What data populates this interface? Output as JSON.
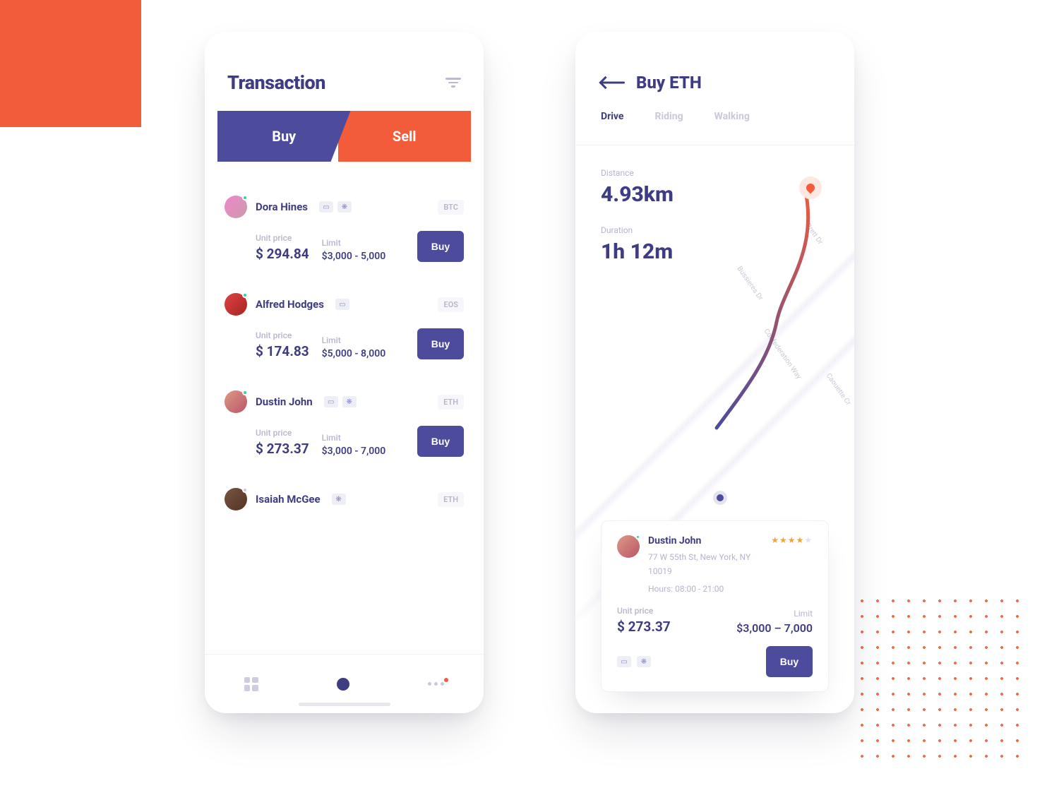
{
  "colors": {
    "primary": "#4D4B9B",
    "accent": "#F25C3B"
  },
  "left": {
    "title": "Transaction",
    "segments": {
      "buy": "Buy",
      "sell": "Sell"
    },
    "labels": {
      "unit_price": "Unit price",
      "limit": "Limit",
      "buy_btn": "Buy"
    },
    "items": [
      {
        "name": "Dora Hines",
        "coin": "BTC",
        "price": "$ 294.84",
        "limit": "$3,000 - 5,000",
        "avatar_bg": "linear-gradient(135deg,#e8c,#c9a)",
        "status": "#35D29A",
        "icons": [
          "card",
          "wechat"
        ]
      },
      {
        "name": "Alfred Hodges",
        "coin": "EOS",
        "price": "$ 174.83",
        "limit": "$5,000 - 8,000",
        "avatar_bg": "linear-gradient(135deg,#d44,#a22)",
        "status": "#35D29A",
        "icons": [
          "card"
        ]
      },
      {
        "name": "Dustin John",
        "coin": "ETH",
        "price": "$ 273.37",
        "limit": "$3,000 - 7,000",
        "avatar_bg": "linear-gradient(135deg,#d98,#b56)",
        "status": "#35D29A",
        "icons": [
          "card",
          "wechat"
        ]
      },
      {
        "name": "Isaiah McGee",
        "coin": "ETH",
        "price": "",
        "limit": "",
        "avatar_bg": "linear-gradient(135deg,#754,#532)",
        "status": "#C9C9D8",
        "icons": [
          "wechat"
        ]
      }
    ]
  },
  "right": {
    "title": "Buy ETH",
    "modes": [
      "Drive",
      "Riding",
      "Walking"
    ],
    "active_mode": 0,
    "distance_label": "Distance",
    "distance": "4.93km",
    "duration_label": "Duration",
    "duration": "1h 12m",
    "streets": [
      "Brett Dr",
      "Bussieres Dr",
      "Confederation Way",
      "Caouette Cr"
    ],
    "card": {
      "name": "Dustin John",
      "rating": 4,
      "rating_max": 5,
      "address": "77 W 55th St, New York, NY 10019",
      "hours": "Hours: 08:00 - 21:00",
      "unit_price_label": "Unit price",
      "price": "$ 273.37",
      "limit_label": "Limit",
      "limit": "$3,000 – 7,000",
      "buy": "Buy"
    }
  }
}
